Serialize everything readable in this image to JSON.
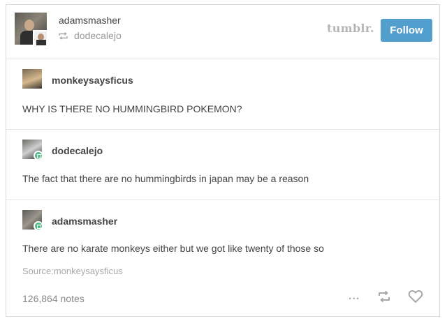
{
  "header": {
    "username": "adamsmasher",
    "reblogged_from": "dodecalejo",
    "brand": "tumblr.",
    "follow_label": "Follow"
  },
  "posts": [
    {
      "username": "monkeysaysficus",
      "text": "WHY IS THERE NO HUMMINGBIRD POKEMON?"
    },
    {
      "username": "dodecalejo",
      "text": "The fact that there are no hummingbirds in japan may be a reason"
    },
    {
      "username": "adamsmasher",
      "text": "There are no karate monkeys either but we got like twenty of those so"
    }
  ],
  "footer": {
    "source_label": "Source:",
    "source_name": "monkeysaysficus",
    "notes": "126,864 notes",
    "more_glyph": "..."
  },
  "colors": {
    "follow_bg": "#529ecc",
    "badge": "#56bc8a",
    "text": "#444444",
    "muted": "#999999"
  },
  "icons": [
    "reblog-icon",
    "more-icon",
    "heart-icon",
    "badge-icon"
  ]
}
